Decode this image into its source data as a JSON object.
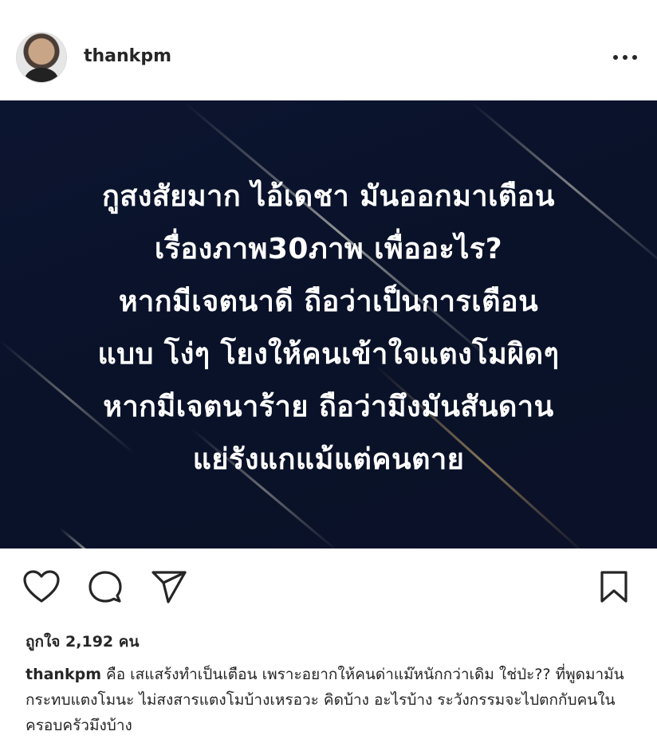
{
  "post": {
    "username": "thankpm",
    "image_text_lines": [
      "กูสงสัยมาก ไอ้เดชา มันออกมาเตือน",
      "เรื่องภาพ30ภาพ เพื่ออะไร?",
      "หากมีเจตนาดี ถือว่าเป็นการเตือน",
      "แบบ โง่ๆ โยงให้คนเข้าใจแตงโมผิดๆ",
      "หากมีเจตนาร้าย ถือว่ามึงมันสันดาน",
      "แย่รังแกแม้แต่คนตาย"
    ],
    "likes_text": "ถูกใจ 2,192 คน",
    "caption_user": "thankpm",
    "caption_text": "คือ เสแสร้งทำเป็นเตือน เพราะอยากให้คนด่าแม๊หนักกว่าเดิม ใช่ป่ะ?? ที่พูดมามันกระทบแตงโมนะ ไม่สงสารแตงโมบ้างเหรอวะ คิดบ้าง อะไรบ้าง ระวังกรรมจะไปตกกับคนในครอบครัวมึงบ้าง"
  },
  "icons": {
    "more": "more-options-icon",
    "like": "heart-icon",
    "comment": "comment-icon",
    "share": "share-icon",
    "save": "bookmark-icon"
  },
  "colors": {
    "background": "#ffffff",
    "text": "#262626",
    "image_background": "#0b1229",
    "image_text": "#ffffff"
  }
}
